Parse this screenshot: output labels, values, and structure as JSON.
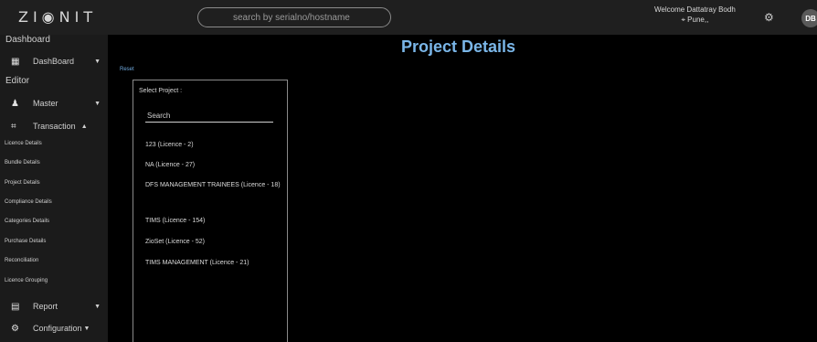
{
  "topbar": {
    "logo": "ZI◉NIT",
    "search_placeholder": "search by serialno/hostname",
    "welcome": "Welcome Dattatray Bodh",
    "location": "⌖ Pune,,",
    "avatar_initials": "DB",
    "settings_icon": "gear-icon"
  },
  "sidebar": {
    "dashboard_title": "Dashboard",
    "dashboard_item": "DashBoard",
    "editor_title": "Editor",
    "master_item": "Master",
    "transaction_item": "Transaction",
    "sub_items": [
      "Licence Details",
      "Bundle Details",
      "Project Details",
      "Compliance Details",
      "Categories Details",
      "Purchase Details",
      "Reconciliation",
      "Licence Grouping"
    ],
    "report_item": "Report",
    "configuration_item": "Configuration"
  },
  "main": {
    "page_title": "Project Details",
    "reset_label": "Reset",
    "panel": {
      "title": "Select Project :",
      "search_placeholder": "Search",
      "projects": [
        "123 (Licence - 2)",
        "NA (Licence - 27)",
        "DFS MANAGEMENT TRAINEES (Licence - 18)",
        "TIMS (Licence - 154)",
        "ZioSet (Licence - 52)",
        "TIMS MANAGEMENT (Licence - 21)"
      ]
    }
  },
  "colors": {
    "accent": "#7ab6e8",
    "topbar_bg": "#1f1f1f",
    "sidebar_bg": "#1b1b1b"
  }
}
